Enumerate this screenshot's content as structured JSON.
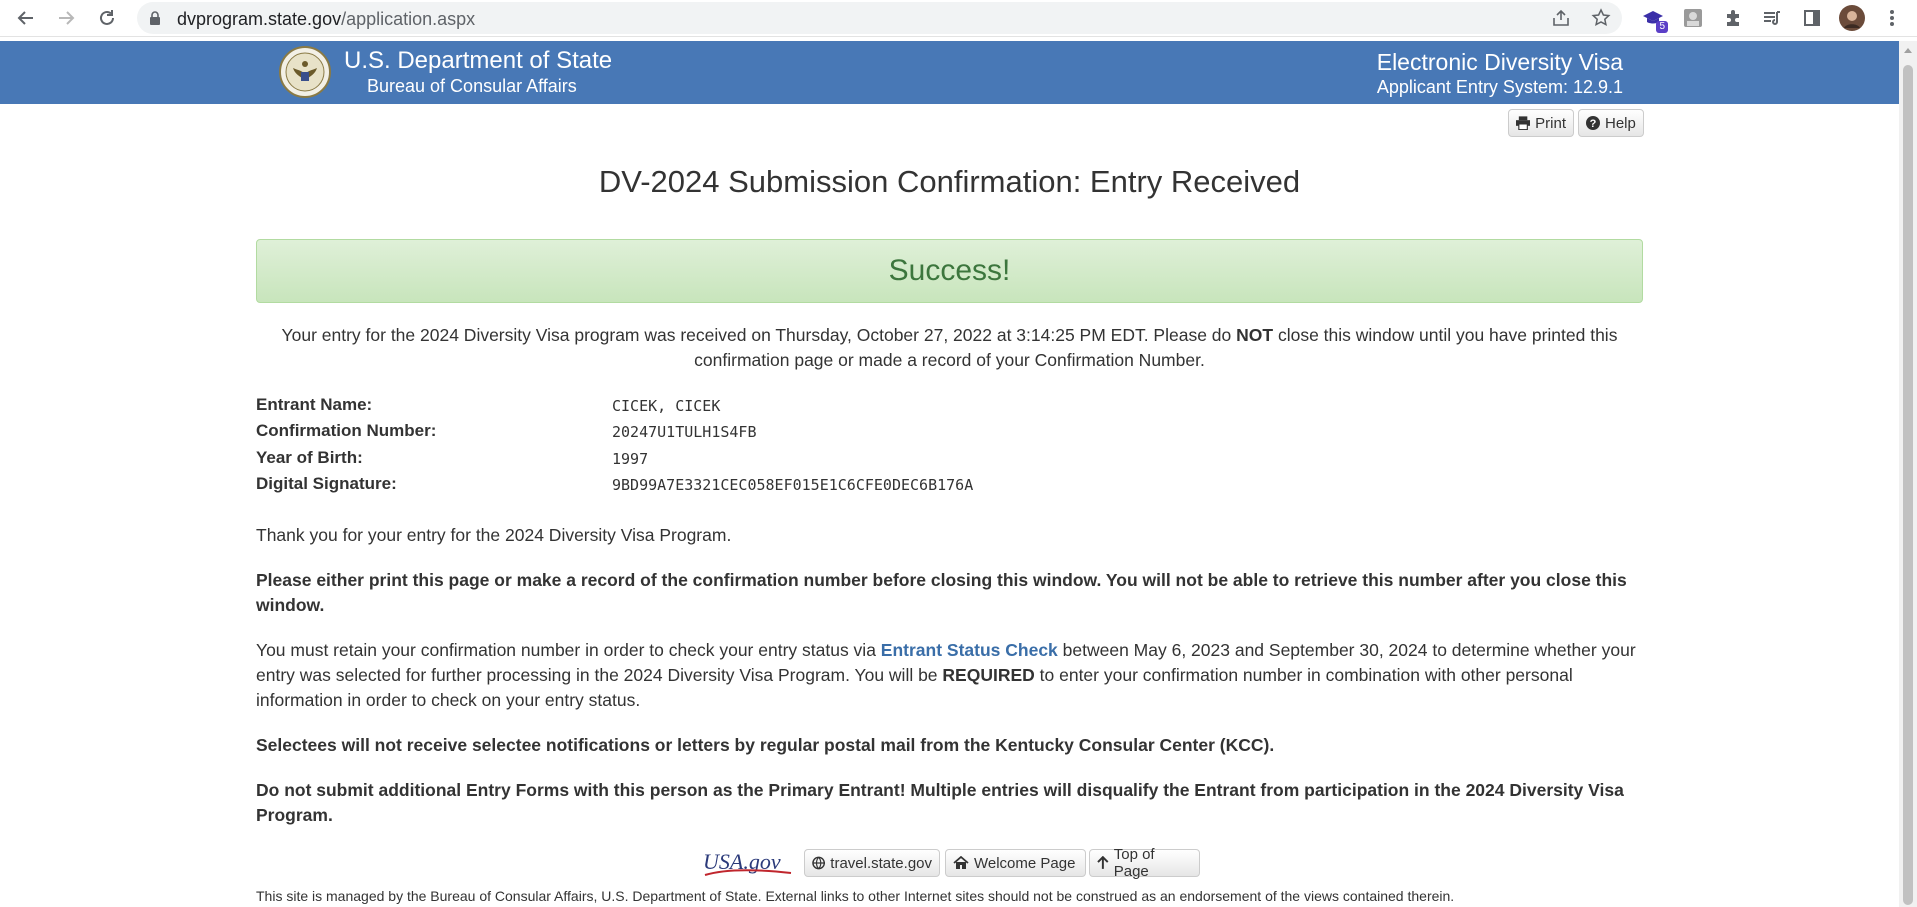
{
  "browser": {
    "url_host": "dvprogram.state.gov",
    "url_path": "/application.aspx",
    "extension_badge": "5"
  },
  "banner": {
    "dept_title": "U.S. Department of State",
    "dept_subtitle": "Bureau of Consular Affairs",
    "system_title": "Electronic Diversity Visa",
    "system_subtitle": "Applicant Entry System: 12.9.1",
    "bg_color": "#4878b6"
  },
  "toolbar": {
    "print_label": "Print",
    "help_label": "Help"
  },
  "page_title": "DV-2024 Submission Confirmation: Entry Received",
  "alert": {
    "text": "Success!",
    "color": "#3c763d"
  },
  "intro": {
    "part1": "Your entry for the 2024 Diversity Visa program was received on Thursday, October 27, 2022 at 3:14:25 PM EDT. Please do ",
    "emphasis": "NOT",
    "part2": " close this window until you have printed this confirmation page or made a record of your Confirmation Number."
  },
  "fields": [
    {
      "label": "Entrant Name:",
      "value": "CICEK, CICEK"
    },
    {
      "label": "Confirmation Number:",
      "value": "20247U1TULH1S4FB"
    },
    {
      "label": "Year of Birth:",
      "value": "1997"
    },
    {
      "label": "Digital Signature:",
      "value": "9BD99A7E3321CEC058EF015E1C6CFE0DEC6B176A"
    }
  ],
  "paragraphs": {
    "thanks": "Thank you for your entry for the 2024 Diversity Visa Program.",
    "print_warning": "Please either print this page or make a record of the confirmation number before closing this window. You will not be able to retrieve this number after you close this window.",
    "retain_part1": "You must retain your confirmation number in order to check your entry status via ",
    "retain_link": "Entrant Status Check",
    "retain_part2": " between May 6, 2023 and September 30, 2024 to determine whether your entry was selected for further processing in the 2024 Diversity Visa Program. You will be ",
    "retain_emphasis": "REQUIRED",
    "retain_part3": " to enter your confirmation number in combination with other personal information in order to check on your entry status.",
    "selectees": "Selectees will not receive selectee notifications or letters by regular postal mail from the Kentucky Consular Center (KCC).",
    "no_duplicates": "Do not submit additional Entry Forms with this person as the Primary Entrant! Multiple entries will disqualify the Entrant from participation in the 2024 Diversity Visa Program."
  },
  "footer": {
    "usa_logo_text": "USA.gov",
    "travel_label": "travel.state.gov",
    "welcome_label": "Welcome Page",
    "top_label": "Top of Page",
    "note": "This site is managed by the Bureau of Consular Affairs, U.S. Department of State. External links to other Internet sites should not be construed as an endorsement of the views contained therein."
  }
}
